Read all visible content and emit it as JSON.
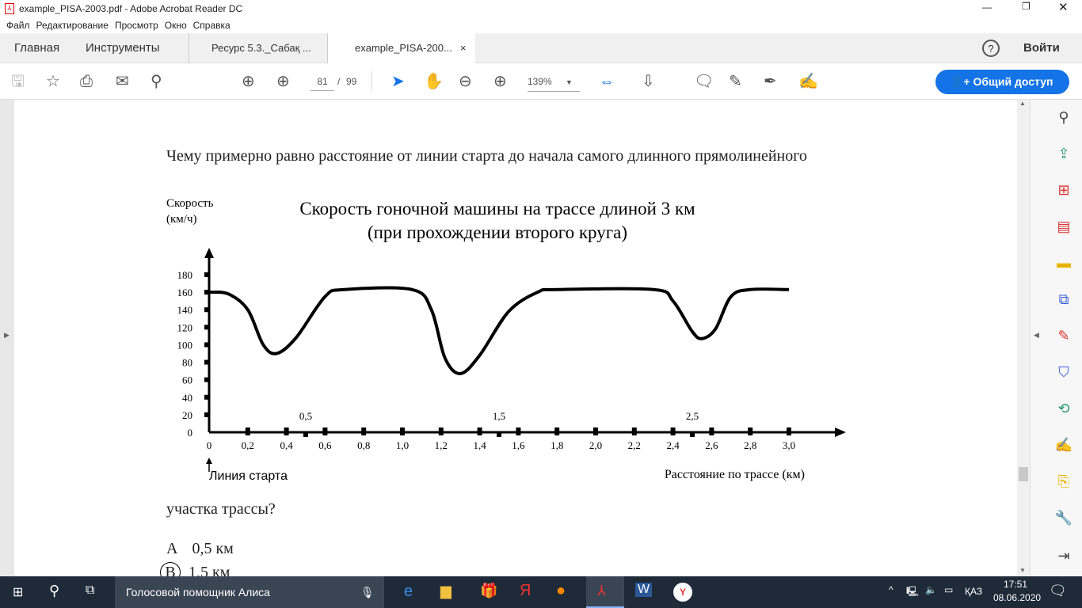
{
  "window": {
    "title": "example_PISA-2003.pdf - Adobe Acrobat Reader DC"
  },
  "menu": [
    "Файл",
    "Редактирование",
    "Просмотр",
    "Окно",
    "Справка"
  ],
  "tabs": {
    "home": "Главная",
    "tools": "Инструменты",
    "doc1": "Ресурс 5.3._Сабақ ...",
    "doc2": "example_PISA-200...",
    "signin": "Войти"
  },
  "toolbar": {
    "page_current": "81",
    "page_sep": "/",
    "page_total": "99",
    "zoom": "139%",
    "share": "Общий доступ"
  },
  "document": {
    "question_start": "Чему примерно равно расстояние от линии старта до начала самого длинного прямолинейного",
    "question_end": "участка трассы?",
    "options": [
      {
        "letter": "A",
        "text": "0,5 км"
      },
      {
        "letter": "B",
        "text": "1,5 км",
        "circled": true
      }
    ]
  },
  "chart_data": {
    "type": "line",
    "title": "Скорость гоночной машины на трассе длиной 3 км",
    "subtitle": "(при прохождении второго круга)",
    "ylabel": "Скорость\n(км/ч)",
    "ylabel_line1": "Скорость",
    "ylabel_line2": "(км/ч)",
    "xlabel": "Расстояние по трассе (км)",
    "annotation": "Линия старта",
    "xlim": [
      0,
      3.0
    ],
    "ylim": [
      0,
      180
    ],
    "x_ticks": [
      "0",
      "0,2",
      "0,4",
      "0,6",
      "0,8",
      "1,0",
      "1,2",
      "1,4",
      "1,6",
      "1,8",
      "2,0",
      "2,2",
      "2,4",
      "2,6",
      "2,8",
      "3,0"
    ],
    "x_half_ticks": [
      "0,5",
      "1,5",
      "2,5"
    ],
    "y_ticks": [
      "0",
      "20",
      "40",
      "60",
      "80",
      "100",
      "120",
      "140",
      "160",
      "180"
    ],
    "grid": false,
    "x": [
      0,
      0.1,
      0.2,
      0.28,
      0.35,
      0.45,
      0.6,
      0.7,
      1.05,
      1.15,
      1.22,
      1.3,
      1.4,
      1.55,
      1.7,
      1.8,
      2.3,
      2.4,
      2.5,
      2.55,
      2.62,
      2.7,
      2.8,
      3.0
    ],
    "y": [
      160,
      158,
      140,
      100,
      90,
      108,
      155,
      163,
      163,
      140,
      85,
      67,
      88,
      138,
      160,
      163,
      163,
      150,
      115,
      107,
      118,
      155,
      163,
      163
    ]
  },
  "taskbar": {
    "search": "Голосовой помощник Алиса",
    "lang": "ҚАЗ",
    "time": "17:51",
    "date": "08.06.2020"
  },
  "colors": {
    "accent": "#1473e6",
    "taskbar": "#1f2a38"
  }
}
